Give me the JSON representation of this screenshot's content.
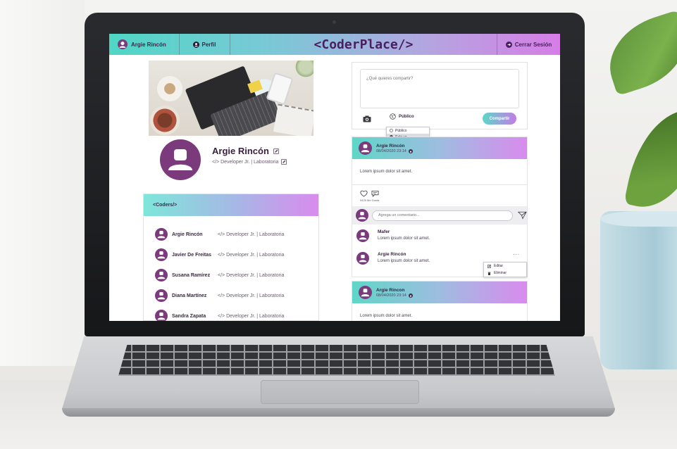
{
  "app": {
    "logo": "<CoderPlace/>",
    "nav_user": "Argie Rincón",
    "nav_profile": "Perfil",
    "nav_logout": "Cerrar Sesión"
  },
  "profile": {
    "name": "Argie Rincón",
    "role": "</> Developer Jr. | Laboratoria"
  },
  "coders": {
    "title": "<Coders/>",
    "items": [
      {
        "name": "Argie Rincón",
        "role": "</> Developer Jr. | Laboratoria"
      },
      {
        "name": "Javier De Freitas",
        "role": "</> Developer Jr. | Laboratoria"
      },
      {
        "name": "Susana Ramírez",
        "role": "</> Developer Jr. | Laboratoria"
      },
      {
        "name": "Diana Martínez",
        "role": "</> Developer Jr. | Laboratoria"
      },
      {
        "name": "Sandra Zapata",
        "role": "</> Developer Jr. | Laboratoria"
      }
    ]
  },
  "composer": {
    "placeholder": "¿Qué quieres compartir?",
    "privacy_label": "Público",
    "share_label": "Compartir",
    "privacy_options": [
      "Público",
      "Solo yo"
    ]
  },
  "posts": [
    {
      "author": "Argie Rincón",
      "date": "08/04/2020 23:14",
      "body": "Lorem ipsum dolor sit amet.",
      "likes": "9425 Me Gusta",
      "comment_placeholder": "Agrega un comentario...",
      "comments": [
        {
          "author": "Mafer",
          "text": "Lorem ipsum dolor sit amet."
        },
        {
          "author": "Argie Rincón",
          "text": "Lorem ipsum dolor sit amet.",
          "more": "..."
        }
      ],
      "comment_menu": [
        "Editar",
        "Eliminar"
      ]
    },
    {
      "author": "Argie Rincon",
      "date": "08/04/2020 23:14",
      "body": "Lorem ipsum dolor sit amet."
    }
  ],
  "colors": {
    "nav_start": "#4fd6c5",
    "nav_end": "#d67ee6",
    "avatar": "#7a3a7c",
    "logo_text": "#4a1e5f"
  }
}
